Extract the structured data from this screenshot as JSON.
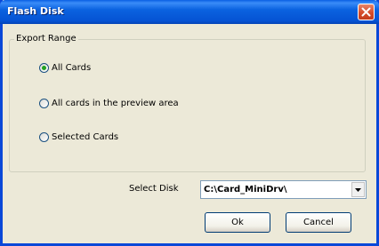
{
  "window": {
    "title": "Flash Disk"
  },
  "export_range": {
    "legend": "Export Range",
    "options": [
      {
        "label": "All Cards",
        "selected": true
      },
      {
        "label": "All cards in the preview area",
        "selected": false
      },
      {
        "label": "Selected Cards",
        "selected": false
      }
    ]
  },
  "select_disk": {
    "label": "Select Disk",
    "value": "C:\\Card_MiniDrv\\"
  },
  "buttons": {
    "ok": "Ok",
    "cancel": "Cancel"
  },
  "icons": {
    "close": "close-icon",
    "dropdown": "chevron-down-icon"
  },
  "colors": {
    "titlebar": "#0b63e0",
    "window_bg": "#ece9d8",
    "radio_selected": "#21a121",
    "close_button": "#d54b2a"
  }
}
